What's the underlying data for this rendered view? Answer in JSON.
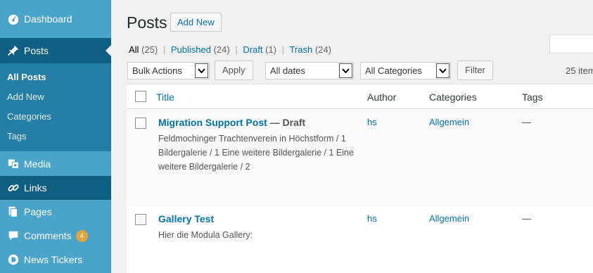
{
  "sidebar": {
    "dashboard": "Dashboard",
    "posts": "Posts",
    "submenu": [
      "All Posts",
      "Add New",
      "Categories",
      "Tags"
    ],
    "media": "Media",
    "links": "Links",
    "pages": "Pages",
    "comments": "Comments",
    "comments_badge": "4",
    "news_tickers": "News Tickers"
  },
  "header": {
    "title": "Posts",
    "add_new": "Add New"
  },
  "filters": {
    "all": "All",
    "all_count": "(25)",
    "published": "Published",
    "published_count": "(24)",
    "draft": "Draft",
    "draft_count": "(1)",
    "trash": "Trash",
    "trash_count": "(24)",
    "sep": "|"
  },
  "toolbar": {
    "bulk_actions": "Bulk Actions",
    "apply": "Apply",
    "dates": "All dates",
    "categories": "All Categories",
    "filter": "Filter",
    "items_count": "25 item"
  },
  "table": {
    "columns": {
      "title": "Title",
      "author": "Author",
      "categories": "Categories",
      "tags": "Tags"
    },
    "rows": [
      {
        "title": "Migration Support Post",
        "state": " — Draft",
        "excerpt": "Feldmochinger Trachtenverein in Höchstform / 1 Bildergalerie / 1 Eine weitere Bildergalerie / 1 Eine weitere Bildergalerie / 2",
        "author": "hs",
        "category": "Allgemein",
        "tags": "—"
      },
      {
        "title": "Gallery Test",
        "state": "",
        "excerpt": "Hier die Modula Gallery:",
        "author": "hs",
        "category": "Allgemein",
        "tags": "—"
      }
    ]
  }
}
